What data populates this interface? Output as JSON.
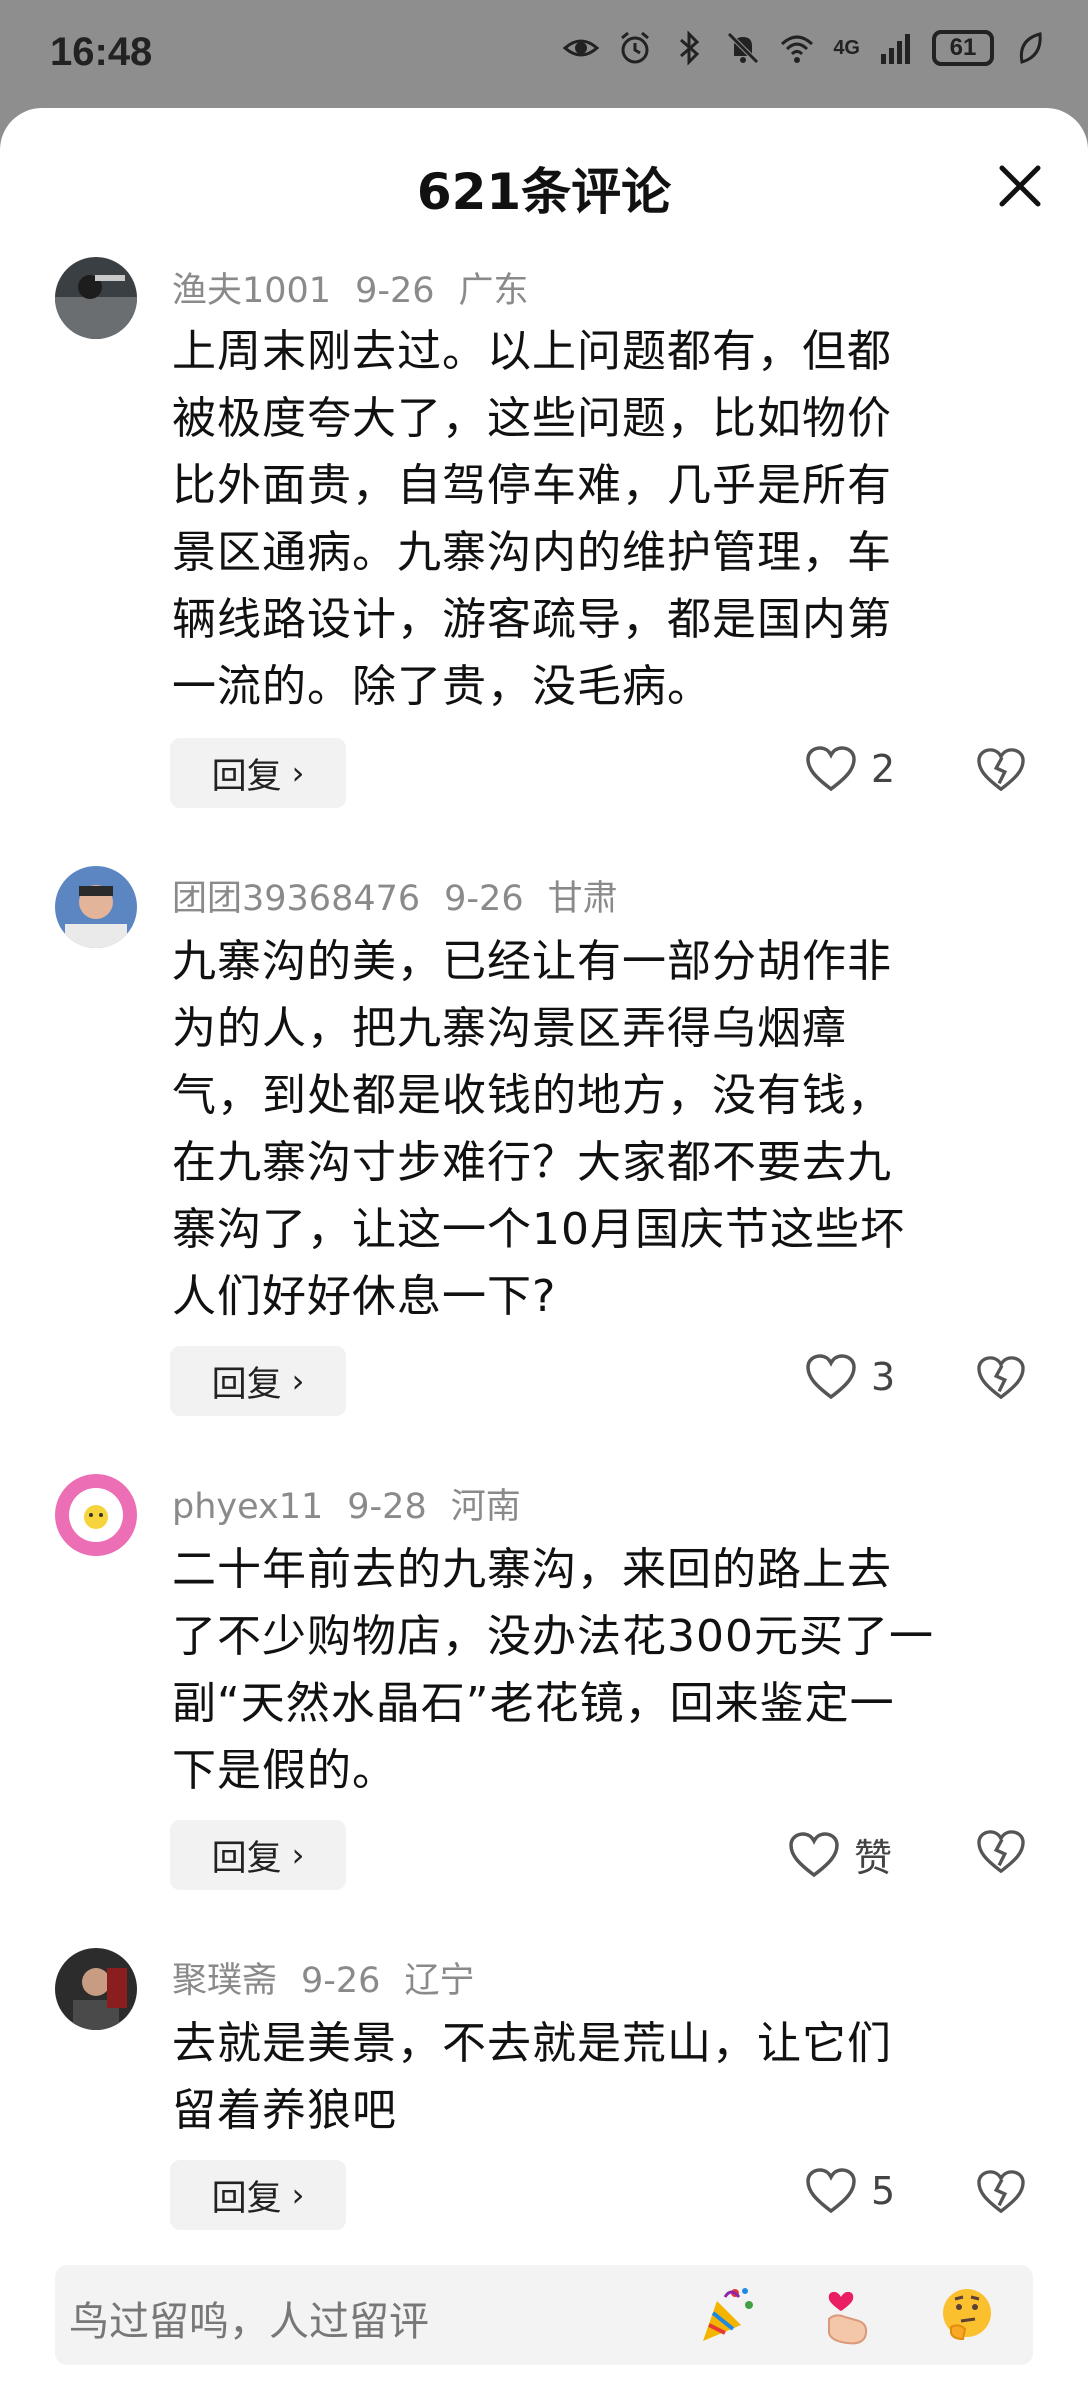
{
  "status_bar": {
    "time": "16:48",
    "signal_label": "4G",
    "battery": "61"
  },
  "sheet": {
    "title": "621条评论"
  },
  "comments": [
    {
      "user": "渔夫1001",
      "date": "9-26",
      "location": "广东",
      "lines": [
        "上周末刚去过。以上问题都有，但都",
        "被极度夸大了，这些问题，比如物价",
        "比外面贵，自驾停车难，几乎是所有",
        "景区通病。九寨沟内的维护管理，车",
        "辆线路设计，游客疏导，都是国内第",
        "一流的。除了贵，没毛病。"
      ],
      "reply_label": "回复",
      "likes": "2"
    },
    {
      "user": "团团39368476",
      "date": "9-26",
      "location": "甘肃",
      "lines": [
        "九寨沟的美，已经让有一部分胡作非",
        "为的人，把九寨沟景区弄得乌烟瘴",
        "气，到处都是收钱的地方，没有钱，",
        "在九寨沟寸步难行？大家都不要去九",
        "寨沟了，让这一个10月国庆节这些坏",
        "人们好好休息一下?"
      ],
      "reply_label": "回复",
      "likes": "3"
    },
    {
      "user": "phyex11",
      "date": "9-28",
      "location": "河南",
      "lines": [
        "二十年前去的九寨沟，来回的路上去",
        "了不少购物店，没办法花300元买了一",
        "副“天然水晶石”老花镜，回来鉴定一",
        "下是假的。"
      ],
      "reply_label": "回复",
      "likes": "赞"
    },
    {
      "user": "聚璞斋",
      "date": "9-26",
      "location": "辽宁",
      "lines": [
        "去就是美景，不去就是荒山，让它们",
        "留着养狼吧"
      ],
      "reply_label": "回复",
      "likes": "5"
    }
  ],
  "input": {
    "placeholder": "鸟过留鸣，人过留评"
  },
  "colors": {
    "status_bg": "#8e8e8e",
    "sheet_bg": "#ffffff",
    "meta_text": "#8a8a8a",
    "button_bg": "#f2f2f2"
  }
}
